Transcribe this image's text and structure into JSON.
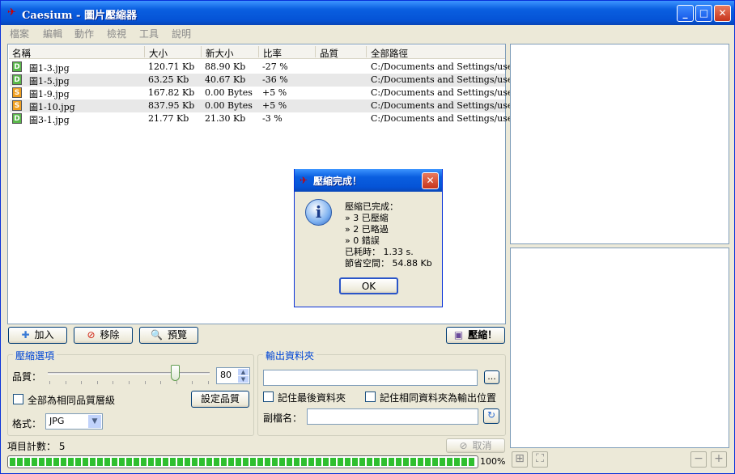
{
  "window": {
    "title": "Caesium - 圖片壓縮器"
  },
  "menu": [
    "檔案",
    "編輯",
    "動作",
    "檢視",
    "工具",
    "說明"
  ],
  "list": {
    "columns": [
      "名稱",
      "大小",
      "新大小",
      "比率",
      "品質",
      "全部路徑"
    ],
    "rows": [
      {
        "status": "D",
        "name": "圖1-3.jpg",
        "size": "120.71 Kb",
        "new_size": "88.90 Kb",
        "ratio": "-27 %",
        "quality": "",
        "path": "C:/Documents and Settings/user/…",
        "alt": false
      },
      {
        "status": "D",
        "name": "圖1-5.jpg",
        "size": "63.25 Kb",
        "new_size": "40.67 Kb",
        "ratio": "-36 %",
        "quality": "",
        "path": "C:/Documents and Settings/user/…",
        "alt": true
      },
      {
        "status": "S",
        "name": "圖1-9.jpg",
        "size": "167.82 Kb",
        "new_size": "0.00 Bytes",
        "ratio": "+5 %",
        "quality": "",
        "path": "C:/Documents and Settings/user/…",
        "alt": false
      },
      {
        "status": "S",
        "name": "圖1-10.jpg",
        "size": "837.95 Kb",
        "new_size": "0.00 Bytes",
        "ratio": "+5 %",
        "quality": "",
        "path": "C:/Documents and Settings/user/…",
        "alt": true
      },
      {
        "status": "D",
        "name": "圖3-1.jpg",
        "size": "21.77 Kb",
        "new_size": "21.30 Kb",
        "ratio": "-3 %",
        "quality": "",
        "path": "C:/Documents and Settings/user/…",
        "alt": false
      }
    ]
  },
  "toolbar": {
    "add": "加入",
    "remove": "移除",
    "preview": "預覽",
    "compress": "壓縮！"
  },
  "compression": {
    "group_title": "壓縮選項",
    "quality_label": "品質：",
    "quality_value": "80",
    "slider_level": 80,
    "same_quality_label": "全部為相同品質層級",
    "set_quality_button": "設定品質",
    "format_label": "格式：",
    "format_value": "JPG"
  },
  "output": {
    "group_title": "輸出資料夾",
    "folder_value": "",
    "browse_button": "...",
    "remember_last_label": "記住最後資料夾",
    "same_folder_label": "記住相同資料夾為輸出位置",
    "suffix_label": "副檔名：",
    "suffix_value": ""
  },
  "status": {
    "item_count": "項目計數： 5",
    "cancel": "取消",
    "progress_text": "100%",
    "progress_level": 1.0
  },
  "dialog": {
    "title": "壓縮完成！",
    "lines": [
      "壓縮已完成：",
      "» 3 已壓縮",
      "» 2 已略過",
      "» 0 錯誤",
      "已耗時： 1.33 s.",
      "節省空間： 54.88 Kb"
    ],
    "ok": "OK"
  },
  "colors": {
    "titlebar": "#0553d6",
    "progress": "#2fbf2f",
    "done_badge": "#5ab84a",
    "skipped_badge": "#f0a020"
  }
}
